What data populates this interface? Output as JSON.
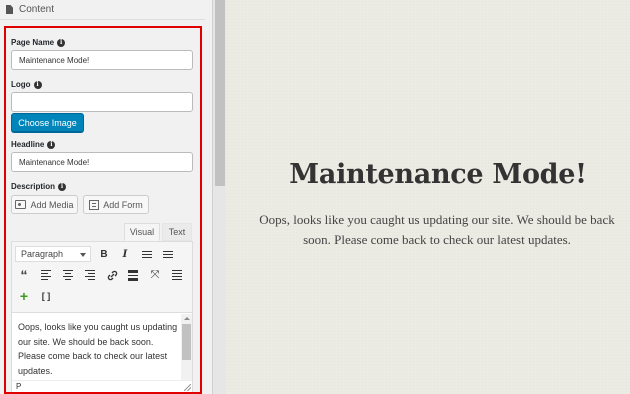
{
  "section": {
    "title": "Content"
  },
  "fields": {
    "page_name": {
      "label": "Page Name",
      "value": "Maintenance Mode!"
    },
    "logo": {
      "label": "Logo",
      "value": "",
      "button": "Choose Image"
    },
    "headline": {
      "label": "Headline",
      "value": "Maintenance Mode!"
    },
    "description": {
      "label": "Description"
    }
  },
  "editor": {
    "add_media": "Add Media",
    "add_form": "Add Form",
    "tabs": [
      "Visual",
      "Text"
    ],
    "format_select": "Paragraph",
    "toolbar": [
      "bold-icon",
      "italic-icon",
      "bullet-list-icon",
      "numbered-list-icon",
      "blockquote-icon",
      "align-left-icon",
      "align-center-icon",
      "align-right-icon",
      "link-icon",
      "read-more-icon",
      "fullscreen-icon",
      "toolbar-toggle-icon",
      "add-plugin-icon",
      "shortcode-icon"
    ],
    "content": "Oops, looks like you caught us updating our site. We should be back soon. Please come back to check our latest updates.",
    "status_path": "P"
  },
  "preview": {
    "headline": "Maintenance Mode!",
    "description": "Oops, looks like you caught us updating our site. We should be back soon. Please come back to check our latest updates."
  },
  "colors": {
    "highlight_border": "#e00000",
    "primary_button": "#0085ba"
  }
}
